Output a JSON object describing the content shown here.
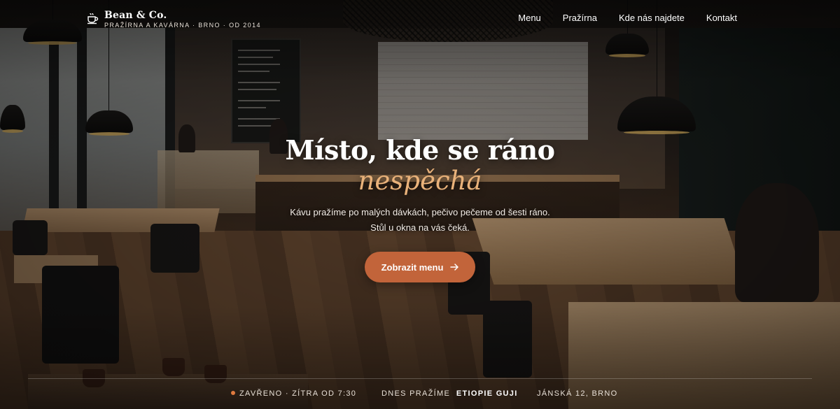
{
  "brand": {
    "name": "Bean & Co.",
    "tagline": "PRAŽÍRNA A KAVÁRNA · BRNO · OD 2014",
    "icon": "coffee-cup-icon"
  },
  "nav": {
    "items": [
      {
        "label": "Menu"
      },
      {
        "label": "Pražírna"
      },
      {
        "label": "Kde nás najdete"
      },
      {
        "label": "Kontakt"
      }
    ]
  },
  "hero": {
    "title": "Místo, kde se ráno",
    "title_accent": "nespěchá",
    "subtitle_line1": "Kávu pražíme po malých dávkách, pečivo pečeme od šesti ráno.",
    "subtitle_line2": "Stůl u okna na vás čeká.",
    "cta_label": "Zobrazit menu",
    "cta_icon": "arrow-right-icon"
  },
  "status": {
    "open_state": "ZAVŘENO · ZÍTRA OD 7:30",
    "roasting_prefix": "DNES PRAŽÍME",
    "roasting_value": "ETIOPIE GUJI",
    "address": "JÁNSKÁ 12, BRNO"
  },
  "colors": {
    "accent": "#c2643a",
    "accent_text": "#e9b27a",
    "status_dot": "#e07a3f"
  }
}
